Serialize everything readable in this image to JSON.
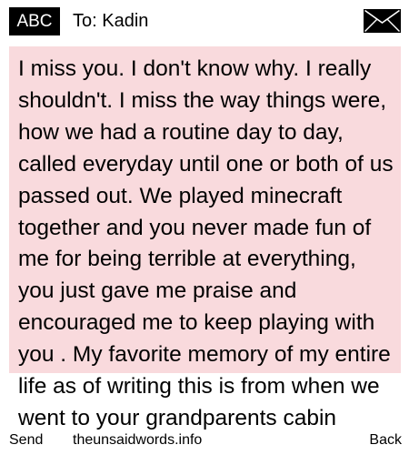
{
  "header": {
    "badge": "ABC",
    "recipient": "To: Kadin",
    "icon": "envelope-icon"
  },
  "message": {
    "text": "I miss you. I don't know why. I really shouldn't. I miss the way things were, how we had a routine day to day, called everyday until one or both of us passed out. We played minecraft together and you never made fun of me for being terrible at everything, you just gave me praise and encouraged me to keep playing with you . My favorite memory of my entire life as of writing this is from when we went to your grandparents cabin",
    "background": "#f9dadd"
  },
  "footer": {
    "send": "Send",
    "site": "theunsaidwords.info",
    "back": "Back"
  }
}
